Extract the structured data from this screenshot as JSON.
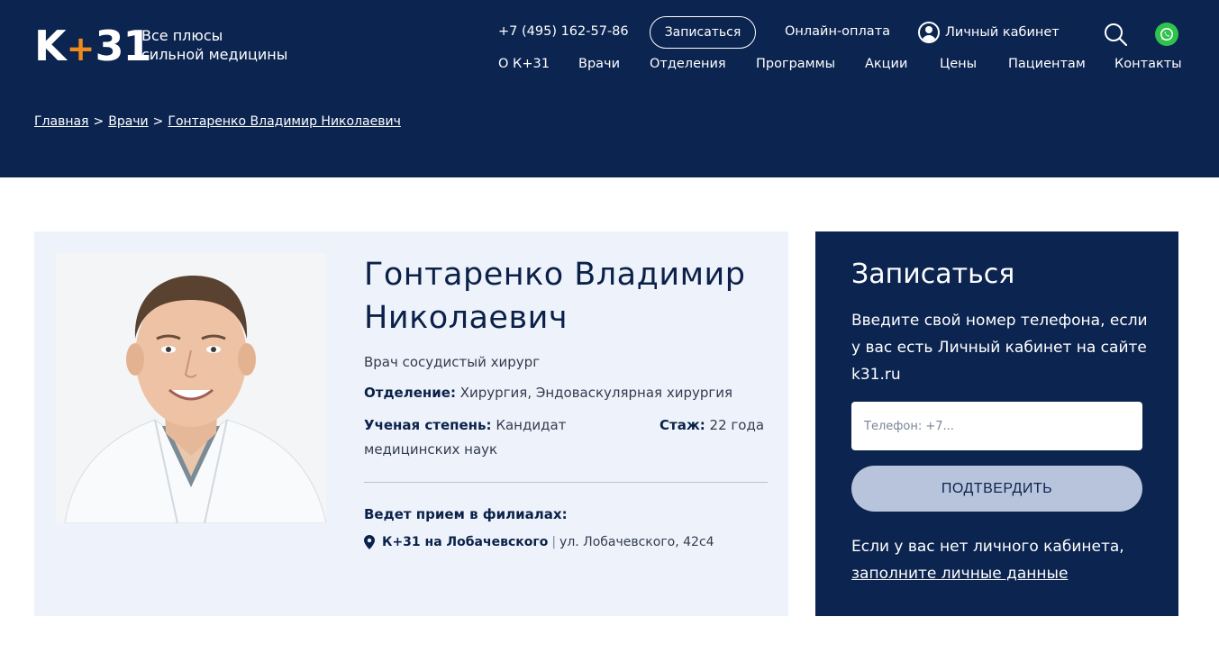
{
  "brand": {
    "logo_text_left": "K",
    "logo_plus": "+",
    "logo_text_right": "31",
    "tagline_line1": "Все плюсы",
    "tagline_line2": "сильной медицины"
  },
  "topbar": {
    "phone": "+7 (495) 162-57-86",
    "book_button": "Записаться",
    "online_payment": "Онлайн-оплата",
    "cabinet": "Личный кабинет",
    "icons": [
      "user-icon",
      "search-icon",
      "whatsapp-icon"
    ]
  },
  "nav": {
    "items": [
      "О К+31",
      "Врачи",
      "Отделения",
      "Программы",
      "Акции",
      "Цены",
      "Пациентам",
      "Контакты"
    ]
  },
  "breadcrumb": {
    "items": [
      "Главная",
      "Врачи",
      "Гонтаренко Владимир Николаевич"
    ],
    "separator": ">"
  },
  "doctor": {
    "name_line1": "Гонтаренко Владимир",
    "name_line2": "Николаевич",
    "specialty": "Врач сосудистый хирург",
    "department_label": "Отделение:",
    "department_value": "Хирургия, Эндоваскулярная хирургия",
    "degree_label": "Ученая степень:",
    "degree_value": "Кандидат медицинских наук",
    "experience_label": "Стаж:",
    "experience_value": "22 года",
    "branches_title": "Ведет прием в филиалах:",
    "branch_name": "К+31 на Лобачевского",
    "branch_separator": "|",
    "branch_address": "ул. Лобачевского, 42с4"
  },
  "booking": {
    "title": "Записаться",
    "description": "Введите свой номер телефона, если у вас есть Личный кабинет на сайте k31.ru",
    "phone_placeholder": "Телефон: +7...",
    "phone_value": "",
    "confirm_button": "ПОДТВЕРДИТЬ",
    "no_cabinet_text": "Если у вас нет личного кабинета,",
    "fill_data_link": "заполните личные данные"
  },
  "colors": {
    "header_bg": "#0b2450",
    "accent_orange": "#f08a1c",
    "card_bg": "#eef3fb",
    "confirm_bg": "#b8c4dc",
    "whatsapp_green": "#2fc24c"
  }
}
